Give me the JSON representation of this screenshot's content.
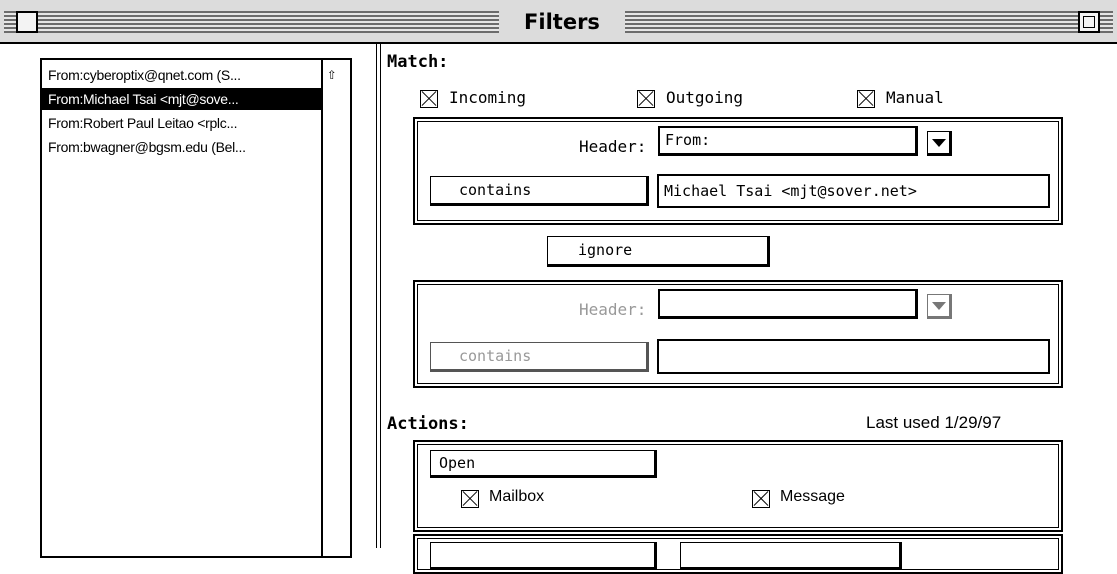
{
  "window": {
    "title": "Filters"
  },
  "filter_list": {
    "items": [
      {
        "label": "From:cyberoptix@qnet.com (S...",
        "selected": false
      },
      {
        "label": "From:Michael Tsai <mjt@sove...",
        "selected": true
      },
      {
        "label": "From:Robert Paul Leitao <rplc...",
        "selected": false
      },
      {
        "label": "From:bwagner@bgsm.edu (Bel...",
        "selected": false
      }
    ]
  },
  "match": {
    "heading": "Match:",
    "incoming_label": "Incoming",
    "incoming_checked": true,
    "outgoing_label": "Outgoing",
    "outgoing_checked": true,
    "manual_label": "Manual",
    "manual_checked": true,
    "condition1": {
      "header_label": "Header:",
      "header_value": "From:",
      "operator": "contains",
      "value": "Michael Tsai <mjt@sover.net>"
    },
    "combinator": "ignore",
    "condition2": {
      "header_label": "Header:",
      "header_value": "",
      "operator": "contains",
      "value": ""
    }
  },
  "actions": {
    "heading": "Actions:",
    "last_used": "Last used 1/29/97",
    "action1": {
      "type": "Open",
      "mailbox_label": "Mailbox",
      "mailbox_checked": true,
      "message_label": "Message",
      "message_checked": true
    }
  }
}
